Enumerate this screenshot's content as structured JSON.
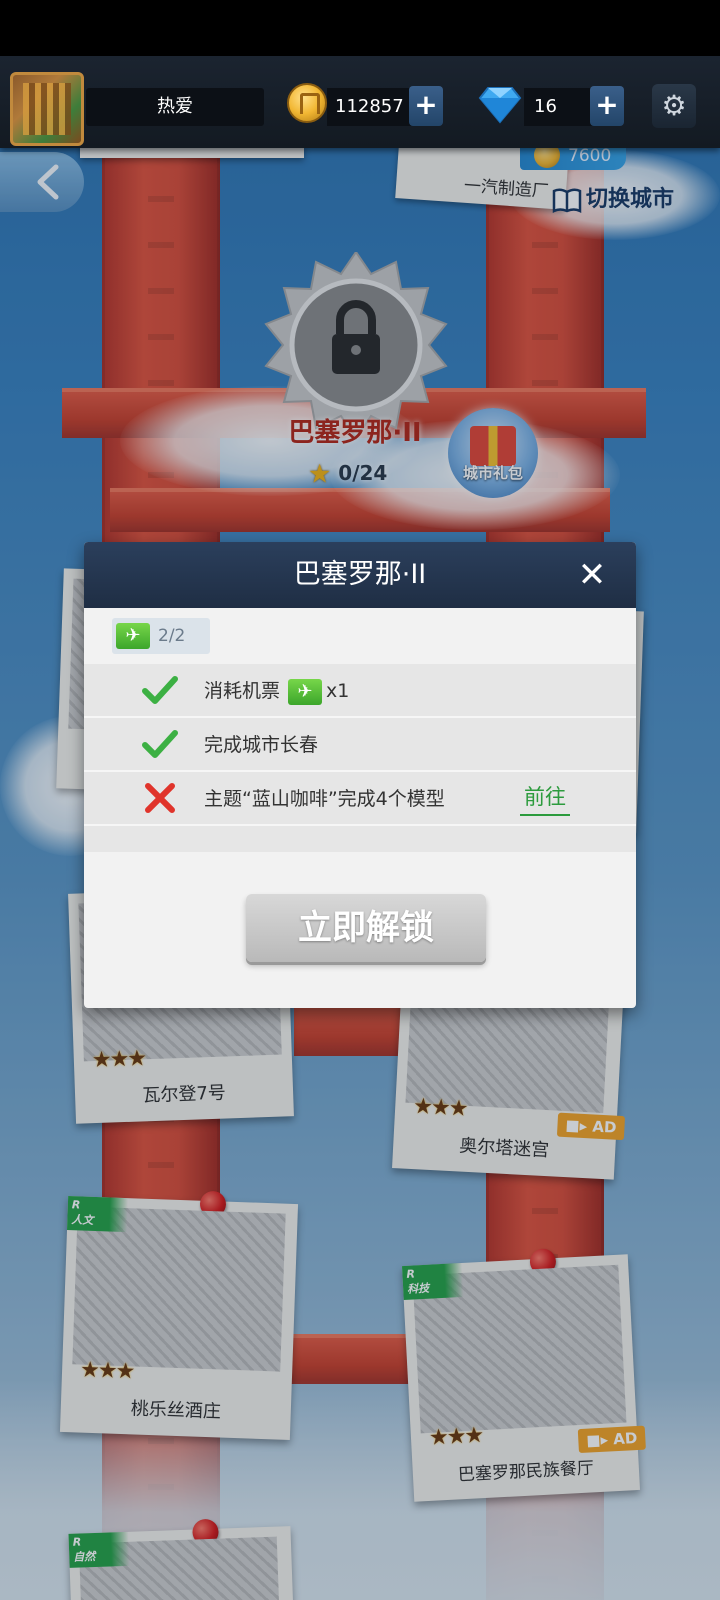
{
  "header": {
    "player_name": "热爱",
    "coins": "112857",
    "gems": "16",
    "coin_plus": "+",
    "gem_plus": "+",
    "settings_icon": "gear-icon"
  },
  "map": {
    "switch_city_label": "切换城市",
    "top_right_card_label": "一汽制造厂",
    "price_badge": "7600",
    "locked_city_name": "巴塞罗那·II",
    "locked_city_progress": "0/24",
    "gift_label": "城市礼包",
    "cards": [
      {
        "name": "瓦尔登7号",
        "stars": "★★★"
      },
      {
        "name": "奥尔塔迷宫",
        "stars": "★★★",
        "ad": "AD"
      },
      {
        "name": "桃乐丝酒庄",
        "stars": "★★★",
        "tag_letter": "R",
        "tag_sub": "人文"
      },
      {
        "name": "巴塞罗那民族餐厅",
        "stars": "★★★",
        "tag_letter": "R",
        "tag_sub": "科技",
        "ad": "AD"
      },
      {
        "name": "",
        "stars": "",
        "tag_letter": "R",
        "tag_sub": "自然"
      }
    ]
  },
  "modal": {
    "title": "巴塞罗那·II",
    "close_label": "✕",
    "ticket_count": "2/2",
    "requirements": [
      {
        "status": "done",
        "text": "消耗机票",
        "suffix": "x1"
      },
      {
        "status": "done",
        "text": "完成城市长春"
      },
      {
        "status": "todo",
        "text": "主题“蓝山咖啡”完成4个模型",
        "action": "前往"
      }
    ],
    "unlock_button": "立即解锁"
  },
  "colors": {
    "accent_green": "#2c9b3d",
    "fail_red": "#e0342b",
    "modal_header": "#24344c",
    "bridge_red": "#d9503c"
  }
}
